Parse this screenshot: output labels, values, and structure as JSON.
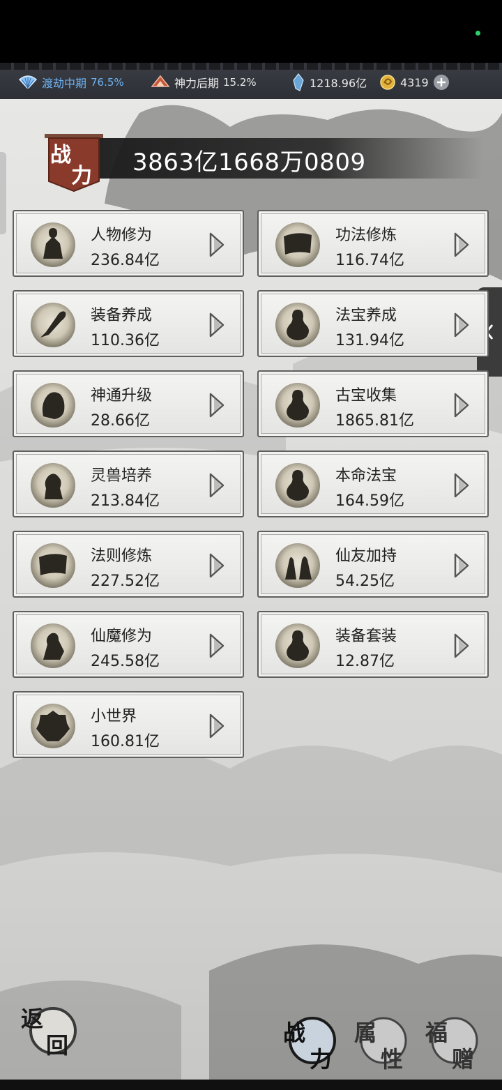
{
  "status": {
    "realm_label": "渡劫中期",
    "realm_pct": "76.5%",
    "divine_label": "神力后期",
    "divine_pct": "15.2%",
    "spirit_stones": "1218.96亿",
    "gold": "4319"
  },
  "power": {
    "badge": [
      "战",
      "力"
    ],
    "value": "3863亿1668万0809"
  },
  "cards": [
    {
      "name": "人物修为",
      "value": "236.84亿",
      "icon": "figure-icon"
    },
    {
      "name": "功法修炼",
      "value": "116.74亿",
      "icon": "scroll-icon"
    },
    {
      "name": "装备养成",
      "value": "110.36亿",
      "icon": "sword-icon"
    },
    {
      "name": "法宝养成",
      "value": "131.94亿",
      "icon": "gourd-icon"
    },
    {
      "name": "神通升级",
      "value": "28.66亿",
      "icon": "bell-icon"
    },
    {
      "name": "古宝收集",
      "value": "1865.81亿",
      "icon": "gourd-icon"
    },
    {
      "name": "灵兽培养",
      "value": "213.84亿",
      "icon": "beast-icon"
    },
    {
      "name": "本命法宝",
      "value": "164.59亿",
      "icon": "gourd-icon"
    },
    {
      "name": "法则修炼",
      "value": "227.52亿",
      "icon": "scroll-icon"
    },
    {
      "name": "仙友加持",
      "value": "54.25亿",
      "icon": "companions-icon"
    },
    {
      "name": "仙魔修为",
      "value": "245.58亿",
      "icon": "demon-icon"
    },
    {
      "name": "装备套装",
      "value": "12.87亿",
      "icon": "gourd-icon"
    },
    {
      "name": "小世界",
      "value": "160.81亿",
      "icon": "world-icon"
    }
  ],
  "bottom": {
    "back": [
      "返",
      "回"
    ],
    "tab_power": [
      "战",
      "力"
    ],
    "tab_attr": [
      "属",
      "性"
    ],
    "tab_gift": [
      "福",
      "赠"
    ]
  },
  "colors": {
    "accent_blue": "#6fb3f2",
    "badge_red": "#8a3a2a"
  }
}
